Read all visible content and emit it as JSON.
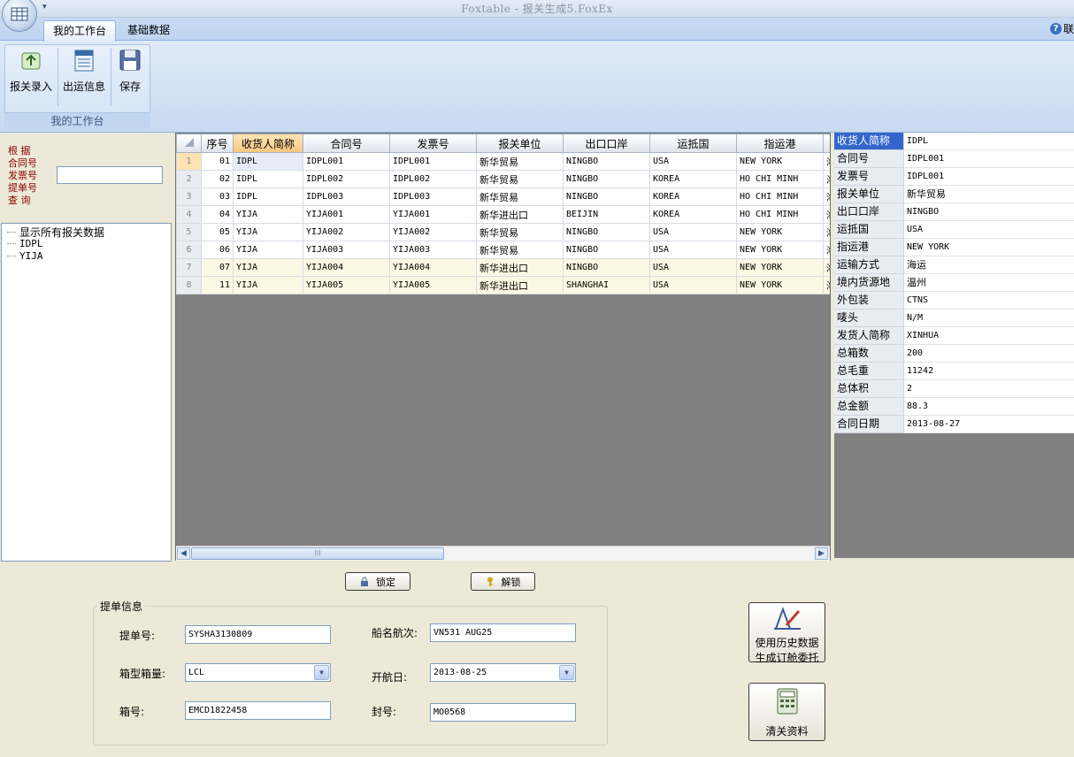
{
  "title": "Foxtable - 报关生成5.FoxEx",
  "tabs": [
    "我的工作台",
    "基础数据"
  ],
  "help_label": "联",
  "ribbon": {
    "group_label": "我的工作台",
    "buttons": [
      "报关录入",
      "出运信息",
      "保存"
    ]
  },
  "query": {
    "labels": [
      "根  据",
      "合同号",
      "发票号",
      "提单号",
      "查  询"
    ],
    "value": ""
  },
  "tree": [
    "显示所有报关数据",
    "IDPL",
    "YIJA"
  ],
  "grid": {
    "columns": [
      "序号",
      "收货人简称",
      "合同号",
      "发票号",
      "报关单位",
      "出口口岸",
      "运抵国",
      "指运港",
      "送"
    ],
    "rows": [
      {
        "n": "1",
        "c": [
          "01",
          "IDPL",
          "IDPL001",
          "IDPL001",
          "新华贸易",
          "NINGBO",
          "USA",
          "NEW YORK",
          "海"
        ]
      },
      {
        "n": "2",
        "c": [
          "02",
          "IDPL",
          "IDPL002",
          "IDPL002",
          "新华贸易",
          "NINGBO",
          "KOREA",
          "HO CHI MINH",
          "海"
        ]
      },
      {
        "n": "3",
        "c": [
          "03",
          "IDPL",
          "IDPL003",
          "IDPL003",
          "新华贸易",
          "NINGBO",
          "KOREA",
          "HO CHI MINH",
          "海"
        ]
      },
      {
        "n": "4",
        "c": [
          "04",
          "YIJA",
          "YIJA001",
          "YIJA001",
          "新华进出口",
          "BEIJIN",
          "KOREA",
          "HO CHI MINH",
          "海"
        ]
      },
      {
        "n": "5",
        "c": [
          "05",
          "YIJA",
          "YIJA002",
          "YIJA002",
          "新华贸易",
          "NINGBO",
          "USA",
          "NEW YORK",
          "海"
        ]
      },
      {
        "n": "6",
        "c": [
          "06",
          "YIJA",
          "YIJA003",
          "YIJA003",
          "新华贸易",
          "NINGBO",
          "USA",
          "NEW YORK",
          "海"
        ]
      },
      {
        "n": "7",
        "c": [
          "07",
          "YIJA",
          "YIJA004",
          "YIJA004",
          "新华进出口",
          "NINGBO",
          "USA",
          "NEW YORK",
          "海"
        ]
      },
      {
        "n": "8",
        "c": [
          "11",
          "YIJA",
          "YIJA005",
          "YIJA005",
          "新华进出口",
          "SHANGHAI",
          "USA",
          "NEW YORK",
          "海"
        ]
      }
    ],
    "scroll_thumb": "III"
  },
  "props": [
    [
      "收货人简称",
      "IDPL"
    ],
    [
      "合同号",
      "IDPL001"
    ],
    [
      "发票号",
      "IDPL001"
    ],
    [
      "报关单位",
      "新华贸易"
    ],
    [
      "出口口岸",
      "NINGBO"
    ],
    [
      "运抵国",
      "USA"
    ],
    [
      "指运港",
      "NEW YORK"
    ],
    [
      "运输方式",
      "海运"
    ],
    [
      "境内货源地",
      "温州"
    ],
    [
      "外包装",
      "CTNS"
    ],
    [
      "唛头",
      "N/M"
    ],
    [
      "发货人简称",
      "XINHUA"
    ],
    [
      "总箱数",
      "200"
    ],
    [
      "总毛重",
      "11242"
    ],
    [
      "总体积",
      "2"
    ],
    [
      "总金额",
      "88.3"
    ],
    [
      "合同日期",
      "2013-08-27"
    ]
  ],
  "buttons": {
    "lock": "锁定",
    "unlock": "解锁"
  },
  "bl": {
    "title": "提单信息",
    "bl_no_label": "提单号:",
    "bl_no": "SYSHA3130809",
    "vessel_label": "船名航次:",
    "vessel": "VN531 AUG25",
    "container_type_label": "箱型箱量:",
    "container_type": "LCL",
    "sail_date_label": "开航日:",
    "sail_date": "2013-08-25",
    "container_no_label": "箱号:",
    "container_no": "EMCD1822458",
    "seal_no_label": "封号:",
    "seal_no": "MO0568"
  },
  "big_buttons": {
    "history_line1": "使用历史数据",
    "history_line2": "生成订舱委托",
    "clearance": "清关资料"
  },
  "colors": {
    "accent": "#3366cc",
    "grid_bg": "#808080",
    "window_bg": "#ece9d8",
    "ribbon": "#c9dbf1"
  }
}
